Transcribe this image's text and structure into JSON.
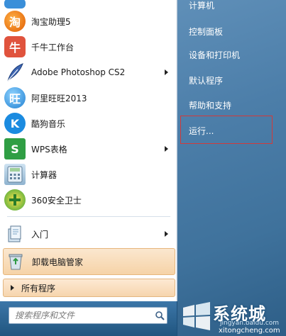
{
  "left_pane": {
    "items": [
      {
        "label": "淘宝助理5",
        "icon": "taobao-assistant-icon",
        "submenu": false
      },
      {
        "label": "千牛工作台",
        "icon": "qianniu-icon",
        "submenu": false
      },
      {
        "label": "Adobe Photoshop CS2",
        "icon": "photoshop-feather-icon",
        "submenu": true
      },
      {
        "label": "阿里旺旺2013",
        "icon": "aliwangwang-icon",
        "submenu": false
      },
      {
        "label": "酷狗音乐",
        "icon": "kugou-icon",
        "submenu": false
      },
      {
        "label": "WPS表格",
        "icon": "wps-spreadsheet-icon",
        "submenu": true
      },
      {
        "label": "计算器",
        "icon": "calculator-icon",
        "submenu": false
      },
      {
        "label": "360安全卫士",
        "icon": "360-safe-icon",
        "submenu": false
      },
      {
        "label": "入门",
        "icon": "getting-started-icon",
        "submenu": true
      },
      {
        "label": "卸载电脑管家",
        "icon": "recycle-bin-icon",
        "submenu": false
      }
    ],
    "all_programs": "所有程序"
  },
  "search": {
    "placeholder": "搜索程序和文件"
  },
  "right_pane": {
    "items": [
      "计算机",
      "控制面板",
      "设备和打印机",
      "默认程序",
      "帮助和支持",
      "运行..."
    ]
  },
  "watermark": {
    "title": "系统城",
    "sub1": "jingyan.baidu.com",
    "sub2": "xitongcheng.com"
  },
  "colors": {
    "highlight_box": "#d23a3a",
    "right_pane": "#4c7ea9",
    "search_bar": "#20557f"
  }
}
